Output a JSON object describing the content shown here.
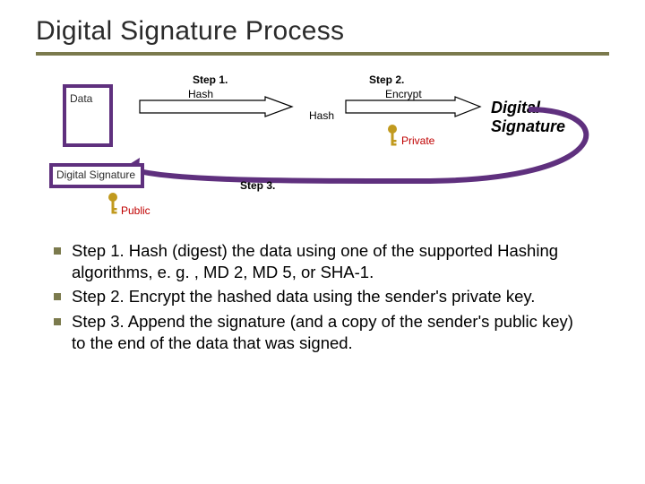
{
  "title": "Digital Signature Process",
  "diagram": {
    "step1_label": "Step 1.",
    "step2_label": "Step 2.",
    "step3_label": "Step 3.",
    "data_box": "Data",
    "dsig_box": "Digital Signature",
    "hash_arrow_label": "Hash",
    "hash_result_label": "Hash",
    "encrypt_arrow_label": "Encrypt",
    "digital_signature_label": "Digital Signature",
    "private_key_label": "Private",
    "public_key_label": "Public",
    "key_color": "#c19a1e"
  },
  "bullets": {
    "item1": "Step 1. Hash (digest) the data using one of the supported Hashing algorithms, e. g. , MD 2, MD 5, or SHA-1.",
    "item2": "Step 2. Encrypt the hashed data using the sender's private key.",
    "item3": "Step 3. Append the signature (and a copy of the sender's public key)  to the end of the data that was signed."
  }
}
